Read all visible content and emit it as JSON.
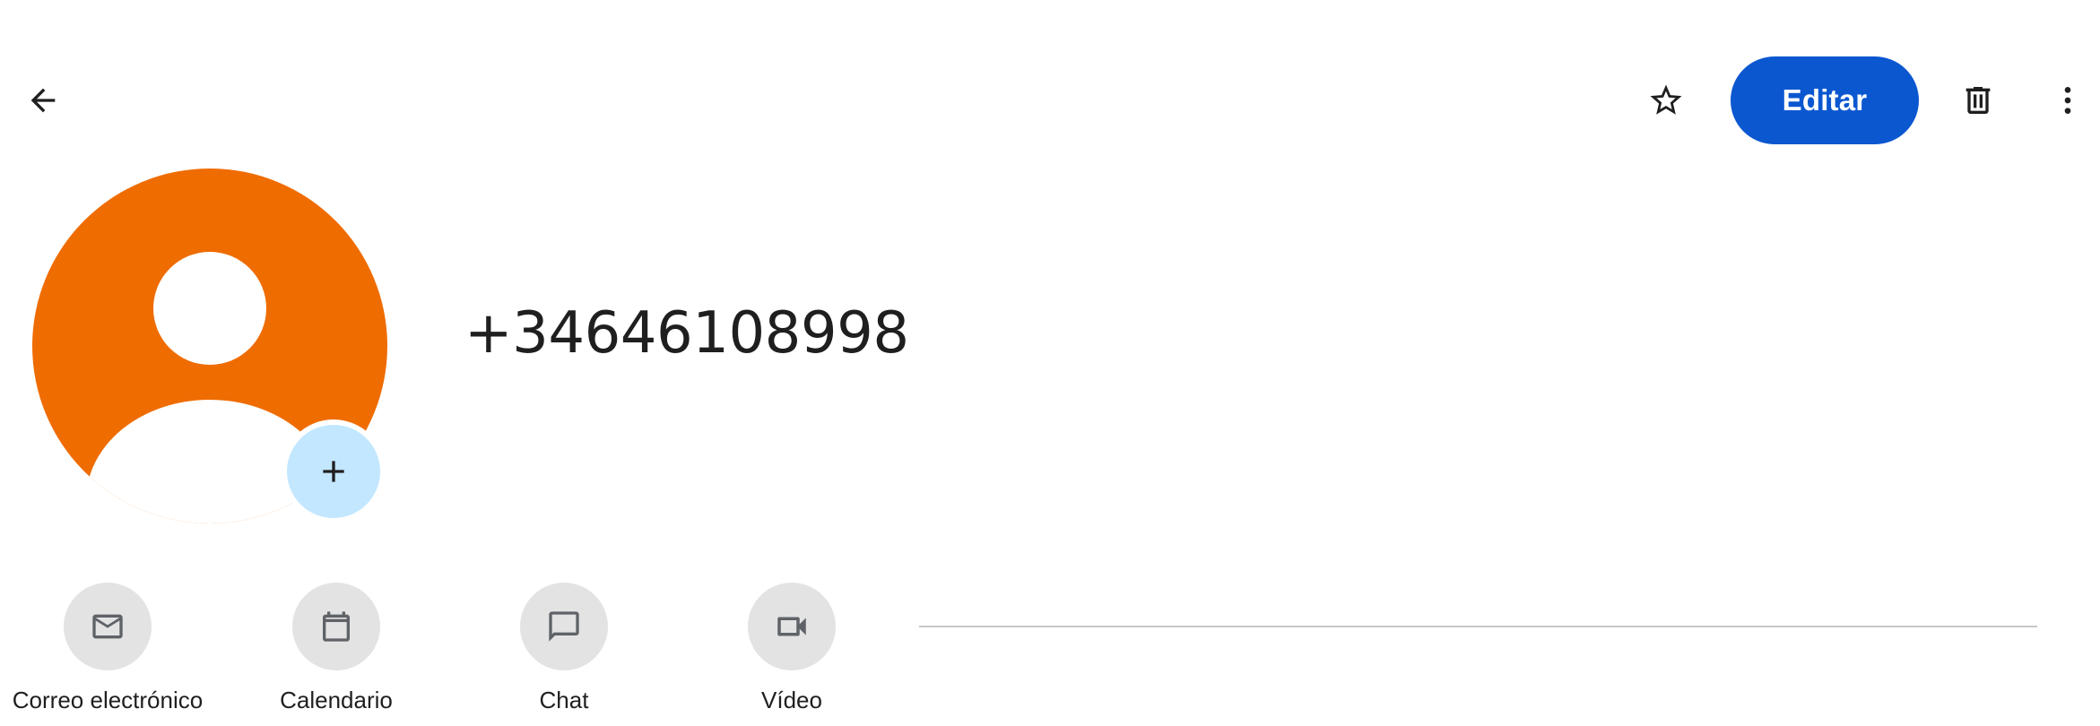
{
  "header": {
    "edit_label": "Editar"
  },
  "contact": {
    "name": "+34646108998",
    "avatar_color": "#ef6c00",
    "add_photo_color": "#c2e7ff"
  },
  "actions": [
    {
      "label": "Correo electrónico",
      "icon": "mail-icon"
    },
    {
      "label": "Calendario",
      "icon": "calendar-icon"
    },
    {
      "label": "Chat",
      "icon": "chat-icon"
    },
    {
      "label": "Vídeo",
      "icon": "video-icon"
    }
  ],
  "colors": {
    "primary": "#0b57d0",
    "action_bg": "#e3e3e3",
    "text": "#1f1f1f",
    "divider": "#c7c7c7"
  }
}
